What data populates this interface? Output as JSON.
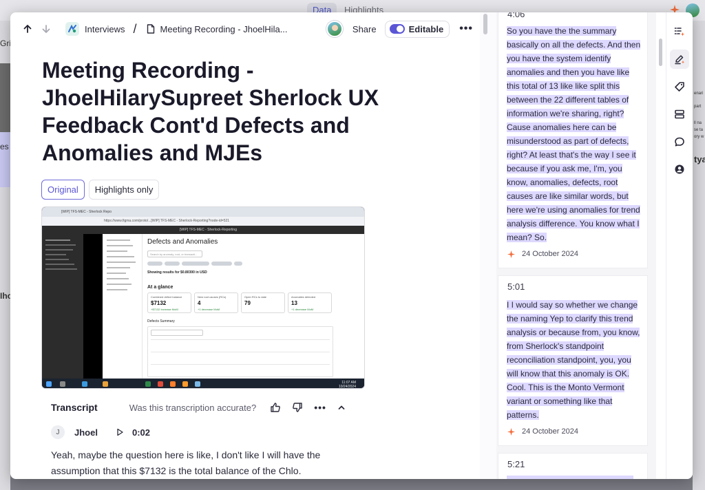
{
  "background": {
    "tabs": [
      "Data",
      "Highlights"
    ],
    "frag_left": [
      "Gri",
      "es",
      "Iho"
    ],
    "frag_right": [
      "enari",
      "part",
      "ll na",
      "se ta",
      "ory w",
      "tya"
    ]
  },
  "header": {
    "app_name": "Interviews",
    "separator": "/",
    "doc_name": "Meeting Recording - JhoelHila...",
    "share_label": "Share",
    "editable_label": "Editable",
    "more_label": "•••"
  },
  "document": {
    "title": "Meeting Recording - JhoelHilarySupreet Sherlock UX Feedback Cont'd Defects and Anomalies and MJEs",
    "views": [
      "Original",
      "Highlights only"
    ]
  },
  "screenshot": {
    "tab_title": "[WIP] TFS-MEC - Sherlock Repo",
    "url": "https://www.figma.com/proto/...[WIP] TFS-MEC - Sherlock-Reporting?node-id=521",
    "figma_title": "[WIP] TFS-MEC - Sherlock-Reporting",
    "heading": "Defects and Anomalies",
    "search_placeholder": "Search by anomaly, root, or transacti...",
    "results_text": "Showing results for $0.80300 in USD",
    "glance_title": "At a glance",
    "cards": [
      {
        "label": "Combined defect balance",
        "value": "$7132",
        "delta": "+$7132 increase MoM"
      },
      {
        "label": "New root causes (RCs)",
        "value": "4",
        "delta": "+1 decrease MoM"
      },
      {
        "label": "Open RCs to date",
        "value": "79",
        "delta": ""
      },
      {
        "label": "Anomalies detected",
        "value": "13",
        "delta": "+1 decrease MoM"
      }
    ],
    "summary_title": "Defects Summary",
    "clock": "11:07 AM\n10/24/2024"
  },
  "transcript": {
    "title": "Transcript",
    "accuracy_question": "Was this transcription accurate?",
    "speaker_initial": "J",
    "speaker_name": "Jhoel",
    "time": "0:02",
    "text": "Yeah, maybe the question here is like, I don't like I will have the assumption that this $7132 is the total balance of the Chlo."
  },
  "highlights": [
    {
      "timestamp": "4:06",
      "text": "So you have the the summary basically on all the defects. And then you have the system identify anomalies and then you have like this total of 13 like like split this between the 22 different tables of information we're sharing, right? Cause anomalies here can be misunderstood as part of defects, right? At least that's the way I see it because if you ask me, I'm, you know, anomalies, defects, root causes are like similar words, but here we're using anomalies for trend analysis difference. You know what I mean? So.",
      "date": "24 October 2024"
    },
    {
      "timestamp": "5:01",
      "text": "I I would say so whether we change the naming Yep to clarify this trend analysis or because from, you know, from Sherlock's standpoint reconciliation standpoint, you, you will know that this anomaly is OK. Cool. This is the Monto Vermont variant or something like that patterns.",
      "date": "24 October 2024"
    },
    {
      "timestamp": "5:21",
      "text": "",
      "date": ""
    }
  ],
  "colors": {
    "accent": "#5b56d6",
    "highlight": "#ddd8ff",
    "ai_sparkle": "#f26b3a"
  }
}
